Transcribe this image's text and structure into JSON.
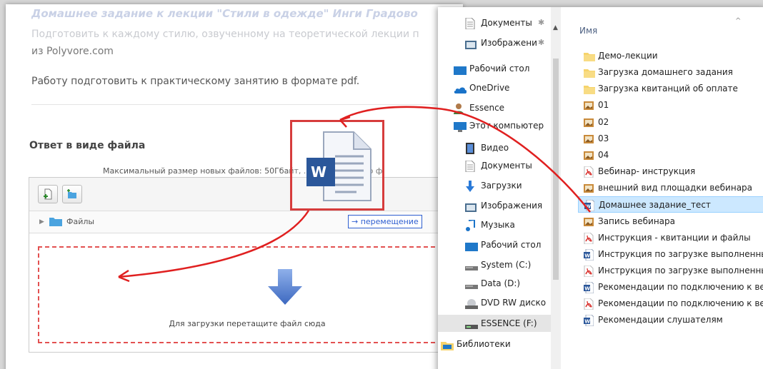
{
  "web": {
    "hw_title": "Домашнее задание к лекции \"Стили в одежде\" Инги Градово",
    "desc_line1": "Подготовить к каждому стилю, озвученному на теоретической лекции п",
    "desc_line2": "из Polyvore.com",
    "desc_line3": "Работу подготовить к практическому занятию в формате pdf.",
    "section_title": "Ответ в виде файла",
    "max_size": "Максимальный размер новых файлов: 50Гбайт, ...    ое количество ф",
    "files_label": "Файлы",
    "drop_text": "Для загрузки перетащите файл сюда",
    "move_badge": "→ перемещение",
    "ghost_letter": "W"
  },
  "explorer": {
    "nav_items": [
      {
        "label": "Документы",
        "icon": "document-icon",
        "pinned": true
      },
      {
        "label": "Изображени",
        "icon": "images-icon",
        "pinned": true
      },
      {
        "label": "Рабочий стол",
        "icon": "desktop-icon"
      },
      {
        "label": "OneDrive",
        "icon": "onedrive-icon"
      },
      {
        "label": "Essence",
        "icon": "user-icon"
      },
      {
        "label": "Этот компьютер",
        "icon": "computer-icon"
      },
      {
        "label": "Видео",
        "icon": "video-icon"
      },
      {
        "label": "Документы",
        "icon": "document-icon"
      },
      {
        "label": "Загрузки",
        "icon": "download-icon"
      },
      {
        "label": "Изображения",
        "icon": "images-icon"
      },
      {
        "label": "Музыка",
        "icon": "music-icon"
      },
      {
        "label": "Рабочий стол",
        "icon": "desktop-icon"
      },
      {
        "label": "System (C:)",
        "icon": "drive-icon"
      },
      {
        "label": "Data (D:)",
        "icon": "drive-icon"
      },
      {
        "label": "DVD RW диско",
        "icon": "dvd-icon"
      },
      {
        "label": "ESSENCE (F:)",
        "icon": "usb-drive-icon"
      },
      {
        "label": "Библиотеки",
        "icon": "library-icon"
      }
    ],
    "column_name": "Имя",
    "files": [
      {
        "label": "Демо-лекции",
        "type": "folder"
      },
      {
        "label": "Загрузка домашнего задания",
        "type": "folder"
      },
      {
        "label": "Загрузка квитанций об оплате",
        "type": "folder"
      },
      {
        "label": "01",
        "type": "image"
      },
      {
        "label": "02",
        "type": "image"
      },
      {
        "label": "03",
        "type": "image"
      },
      {
        "label": "04",
        "type": "image"
      },
      {
        "label": "Вебинар- инструкция",
        "type": "pdf"
      },
      {
        "label": "внешний вид площадки вебинара",
        "type": "image"
      },
      {
        "label": "Домашнее задание_тест",
        "type": "word"
      },
      {
        "label": "Запись вебинара",
        "type": "image"
      },
      {
        "label": "Инструкция - квитанции и файлы",
        "type": "pdf"
      },
      {
        "label": "Инструкция по загрузке выполненны",
        "type": "word"
      },
      {
        "label": "Инструкция по загрузке выполненны",
        "type": "pdf"
      },
      {
        "label": "Рекомендации по подключению к ве",
        "type": "word"
      },
      {
        "label": "Рекомендации по подключению к ве",
        "type": "pdf"
      },
      {
        "label": "Рекомендации слушателям",
        "type": "word"
      }
    ],
    "selected_file": "Домашнее задание_тест"
  },
  "colors": {
    "accent_red": "#e02020",
    "selection_blue": "#cce8ff",
    "word_blue": "#2b579a",
    "folder_yellow": "#f6d36b",
    "pdf_red": "#d9302c",
    "drop_arrow_blue": "#4a78c9"
  }
}
